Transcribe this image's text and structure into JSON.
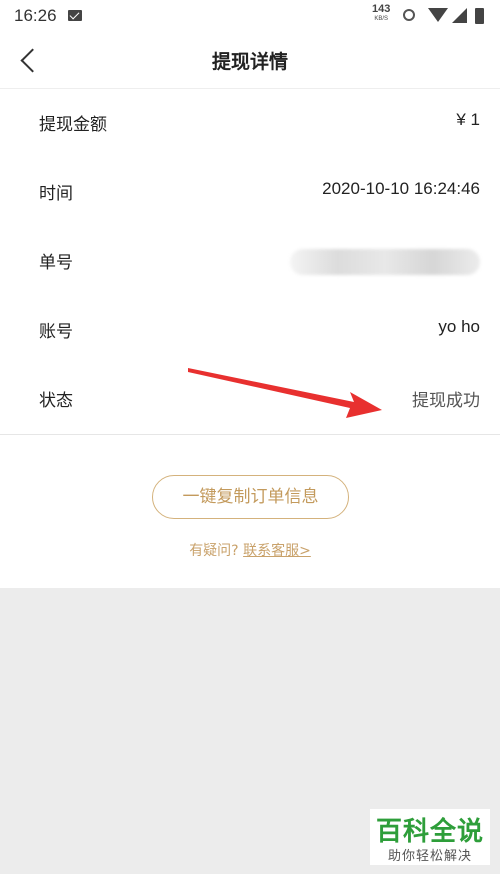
{
  "status_bar": {
    "time": "16:26",
    "net_speed": "143",
    "net_unit": "KB/S"
  },
  "nav": {
    "title": "提现详情"
  },
  "details": {
    "amount_label": "提现金额",
    "amount_value": "¥ 1",
    "time_label": "时间",
    "time_value": "2020-10-10 16:24:46",
    "order_label": "单号",
    "account_label": "账号",
    "account_value": "yo ho",
    "status_label": "状态",
    "status_value": "提现成功"
  },
  "actions": {
    "copy_label": "一键复制订单信息",
    "question_text": "有疑问?",
    "contact_link": "联系客服>"
  },
  "watermark": {
    "title": "百科全说",
    "subtitle": "助你轻松解决"
  },
  "colors": {
    "accent_gold": "#c39a5c",
    "arrow_red": "#e8302f",
    "watermark_green": "#2e9e3a"
  }
}
